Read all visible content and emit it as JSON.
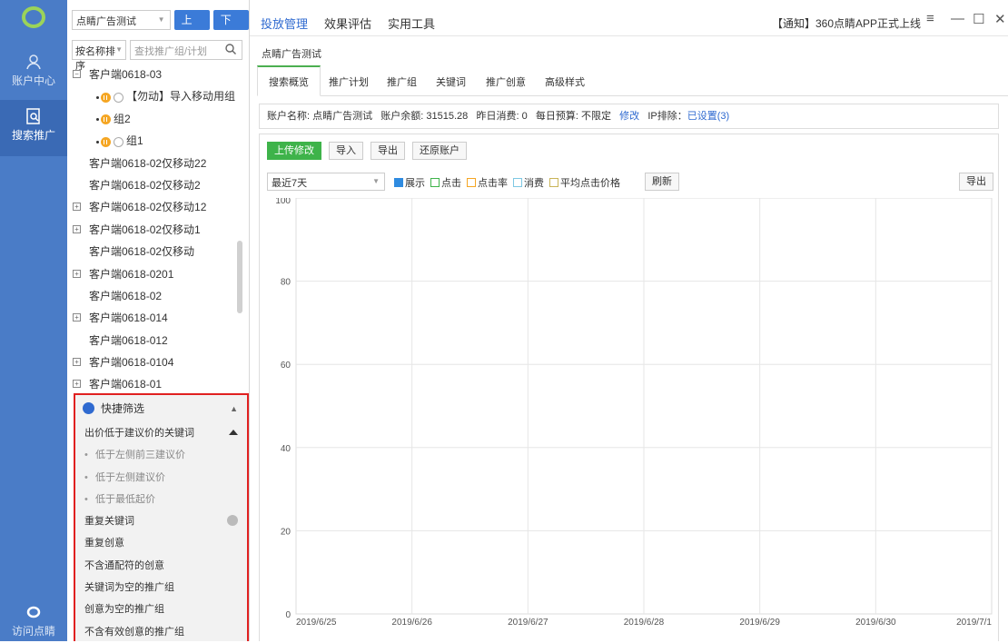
{
  "rail": {
    "items": [
      {
        "label": "账户中心"
      },
      {
        "label": "搜索推广"
      },
      {
        "label": "访问点睛"
      }
    ]
  },
  "left": {
    "account_select": "点睛广告测试",
    "upload": "上传",
    "download": "下载",
    "sort_select": "按名称排序",
    "search_placeholder": "查找推广组/计划",
    "tree": [
      {
        "label": "客户端0618-03",
        "expand": "−",
        "level": 0
      },
      {
        "label": "【勿动】导入移动用组",
        "level": 1
      },
      {
        "label": "组2",
        "level": 1
      },
      {
        "label": "组1",
        "level": 1
      },
      {
        "label": "客户端0618-02仅移动22",
        "level": 0
      },
      {
        "label": "客户端0618-02仅移动2",
        "level": 0
      },
      {
        "label": "客户端0618-02仅移动12",
        "expand": "+",
        "level": 0
      },
      {
        "label": "客户端0618-02仅移动1",
        "expand": "+",
        "level": 0
      },
      {
        "label": "客户端0618-02仅移动",
        "level": 0
      },
      {
        "label": "客户端0618-0201",
        "expand": "+",
        "level": 0
      },
      {
        "label": "客户端0618-02",
        "level": 0
      },
      {
        "label": "客户端0618-014",
        "expand": "+",
        "level": 0
      },
      {
        "label": "客户端0618-012",
        "level": 0
      },
      {
        "label": "客户端0618-0104",
        "expand": "+",
        "level": 0
      },
      {
        "label": "客户端0618-01",
        "expand": "+",
        "level": 0
      }
    ],
    "quick_filter": {
      "title": "快捷筛选",
      "items": [
        {
          "label": "出价低于建议价的关键词",
          "type": "head"
        },
        {
          "label": "低于左侧前三建议价",
          "type": "sub"
        },
        {
          "label": "低于左侧建议价",
          "type": "sub"
        },
        {
          "label": "低于最低起价",
          "type": "sub"
        },
        {
          "label": "重复关键词",
          "type": "gear"
        },
        {
          "label": "重复创意",
          "type": "plain"
        },
        {
          "label": "不含通配符的创意",
          "type": "plain"
        },
        {
          "label": "关键词为空的推广组",
          "type": "plain"
        },
        {
          "label": "创意为空的推广组",
          "type": "plain"
        },
        {
          "label": "不含有效创意的推广组",
          "type": "plain"
        }
      ]
    }
  },
  "top": {
    "tabs": [
      "投放管理",
      "效果评估",
      "实用工具"
    ],
    "notice": "【通知】360点睛APP正式上线"
  },
  "main": {
    "breadcrumb": "点睛广告测试",
    "subtabs": [
      "搜索概览",
      "推广计划",
      "推广组",
      "关键词",
      "推广创意",
      "高级样式"
    ],
    "account_info": {
      "name_label": "账户名称: 点睛广告测试",
      "balance_label": "账户余额: 31515.28",
      "yesterday_label": "昨日消费: 0",
      "budget_label": "每日预算: 不限定",
      "modify": "修改",
      "ip_label": "IP排除：",
      "ip_link": "已设置(3)"
    },
    "actions": [
      "上传修改",
      "导入",
      "导出",
      "还原账户"
    ],
    "range": "最近7天",
    "legend": [
      {
        "label": "展示",
        "color": "#2f8be0",
        "checked": true
      },
      {
        "label": "点击",
        "color": "#3eb34a",
        "checked": false
      },
      {
        "label": "点击率",
        "color": "#f5a623",
        "checked": false
      },
      {
        "label": "消费",
        "color": "#7ec8e3",
        "checked": false
      },
      {
        "label": "平均点击价格",
        "color": "#c9b458",
        "checked": false
      }
    ],
    "refresh": "刷新",
    "export": "导出"
  },
  "chart_data": {
    "type": "line",
    "x": [
      "2019/6/25",
      "2019/6/26",
      "2019/6/27",
      "2019/6/28",
      "2019/6/29",
      "2019/6/30",
      "2019/7/1"
    ],
    "series": [
      {
        "name": "展示",
        "values": [
          0,
          0,
          0,
          0,
          0,
          0,
          0
        ]
      }
    ],
    "ylim": [
      0,
      100
    ],
    "yticks": [
      0,
      20,
      40,
      60,
      80,
      100
    ],
    "grid": true
  }
}
